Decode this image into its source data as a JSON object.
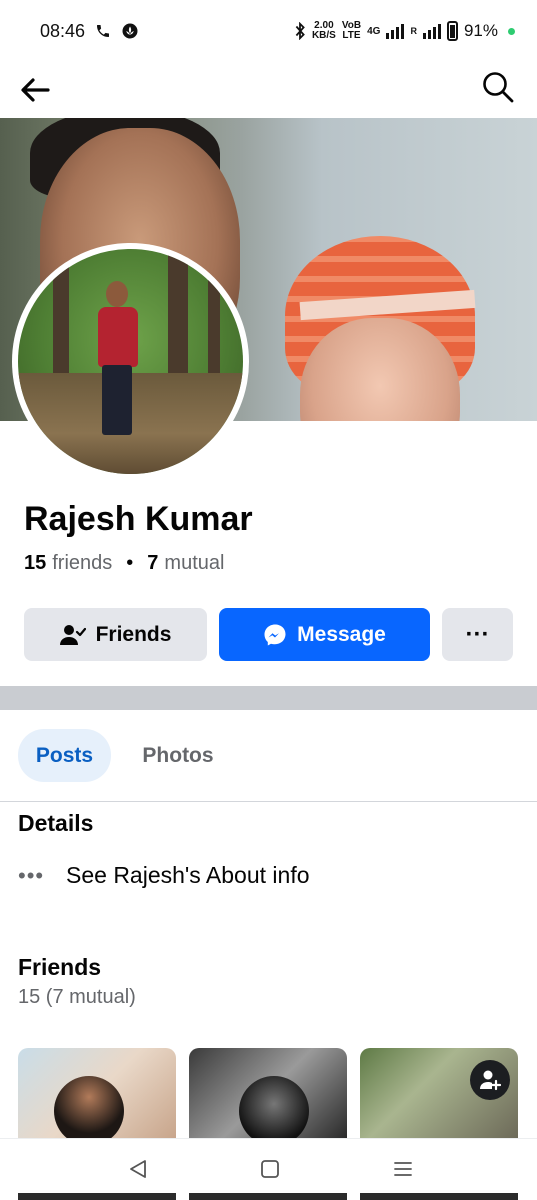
{
  "status_bar": {
    "time": "08:46",
    "net_speed_value": "2.00",
    "net_speed_unit": "KB/S",
    "vo_top": "VoB",
    "vo_bottom": "LTE",
    "signal_tag": "4G",
    "roaming": "R",
    "battery": "91%"
  },
  "nav": {
    "back_icon": "arrow-left-icon",
    "search_icon": "search-icon"
  },
  "profile": {
    "name": "Rajesh Kumar",
    "friends_count": "15",
    "friends_word": "friends",
    "mutual_count": "7",
    "mutual_word": "mutual"
  },
  "actions": {
    "friends_label": "Friends",
    "message_label": "Message",
    "more_label": "···"
  },
  "tabs": [
    {
      "label": "Posts",
      "active": true
    },
    {
      "label": "Photos",
      "active": false
    }
  ],
  "details": {
    "title": "Details",
    "about_label": "See Rajesh's About info"
  },
  "friends_section": {
    "title": "Friends",
    "subtitle": "15 (7 mutual)"
  },
  "colors": {
    "brand_blue": "#0866ff",
    "tab_active_bg": "#e6f0fb",
    "tab_active_text": "#0a5fc2",
    "button_grey": "#e4e6eb"
  }
}
